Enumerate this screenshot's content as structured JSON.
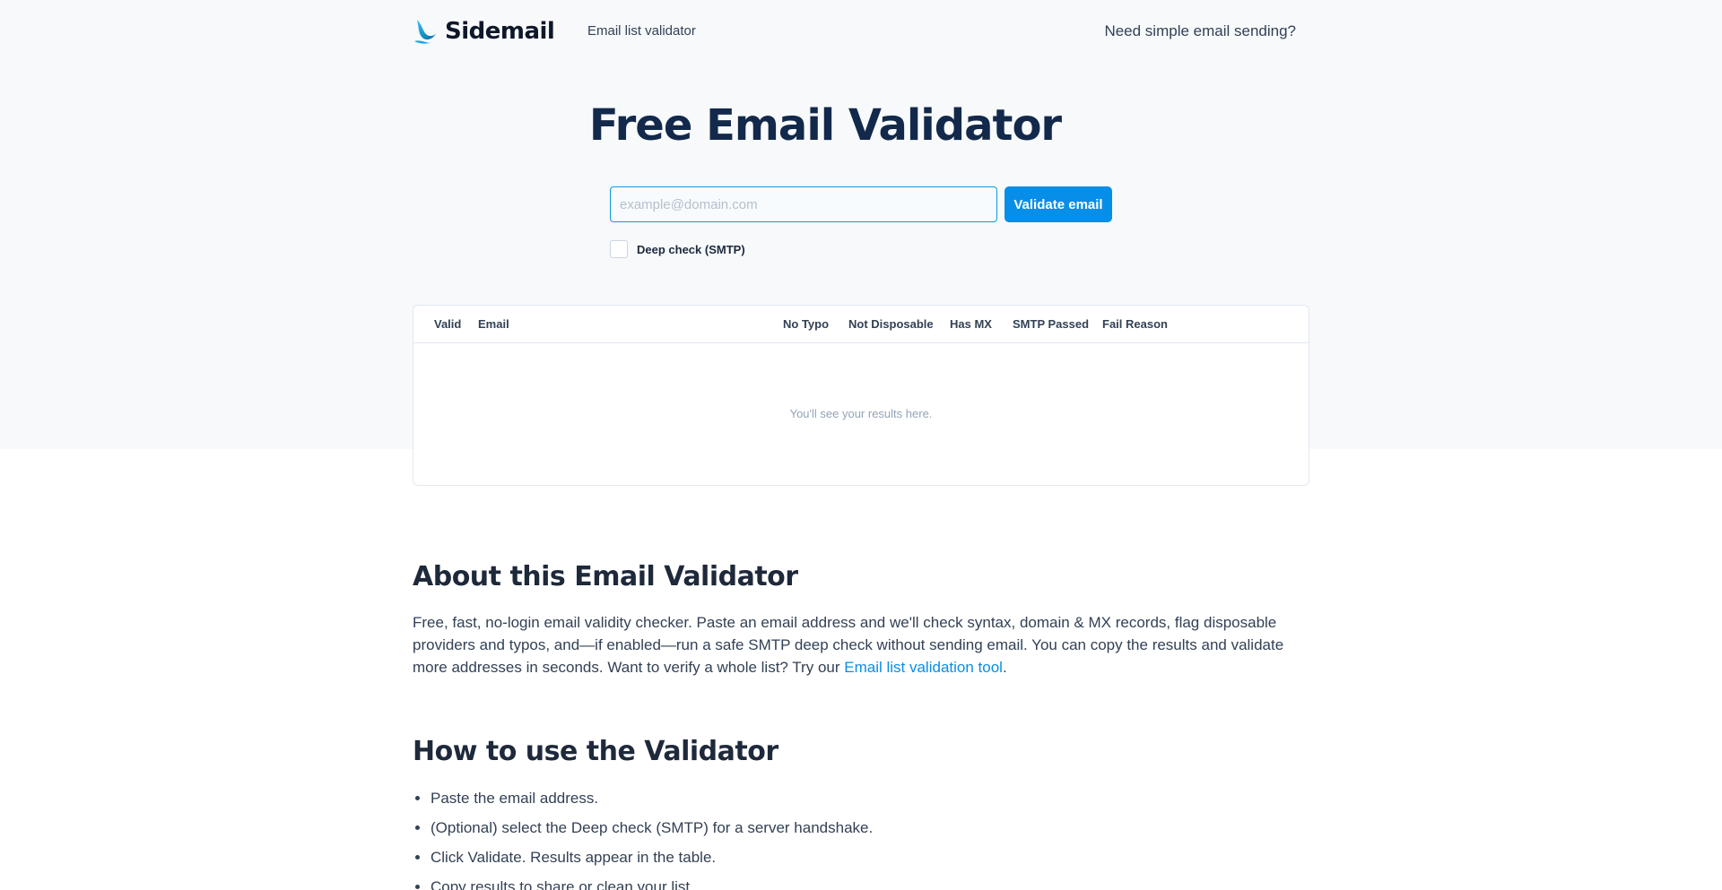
{
  "header": {
    "brand": "Sidemail",
    "nav_link": "Email list validator",
    "right_link": "Need simple email sending?"
  },
  "hero": {
    "title": "Free Email Validator",
    "input_placeholder": "example@domain.com",
    "input_value": "",
    "validate_label": "Validate email",
    "deep_check_label": "Deep check (SMTP)",
    "deep_check_checked": false
  },
  "results": {
    "columns": [
      "Valid",
      "Email",
      "No Typo",
      "Not Disposable",
      "Has MX",
      "SMTP Passed",
      "Fail Reason"
    ],
    "rows": [],
    "empty_message": "You'll see your results here."
  },
  "about": {
    "heading": "About this Email Validator",
    "text": "Free, fast, no-login email validity checker. Paste an email address and we'll check syntax, domain & MX records, flag disposable providers and typos, and—if enabled—run a safe SMTP deep check without sending email. You can copy the results and validate more addresses in seconds. Want to verify a whole list? Try our ",
    "link_text": "Email list validation tool",
    "text_end": "."
  },
  "howto": {
    "heading": "How to use the Validator",
    "steps": [
      "Paste the email address.",
      "(Optional) select the Deep check (SMTP) for a server handshake.",
      "Click Validate. Results appear in the table.",
      "Copy results to share or clean your list."
    ]
  },
  "colors": {
    "accent": "#078ee8",
    "title": "#13294b",
    "hero_bg": "#f7f9fb"
  },
  "icons": {
    "logo": "sidemail-bird-icon"
  }
}
